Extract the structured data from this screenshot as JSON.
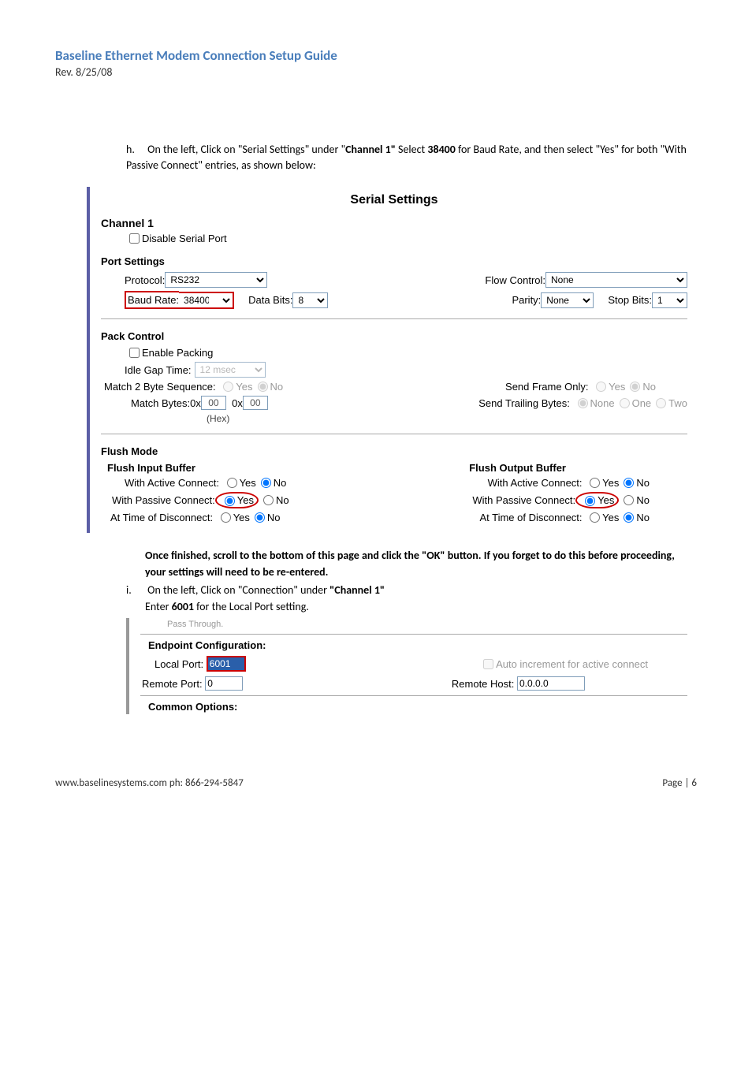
{
  "header": {
    "title": "Baseline Ethernet Modem Connection Setup Guide",
    "rev": "Rev. 8/25/08"
  },
  "instr_h": {
    "letter": "h.",
    "text1": "On the left, Click on \"Serial Settings\" under \"",
    "bold1": "Channel 1\"",
    "text2": "  Select ",
    "bold2": "38400",
    "text3": " for Baud Rate, and then select \"Yes\" for both \"With Passive Connect\" entries, as shown below:"
  },
  "serial": {
    "title": "Serial Settings",
    "channel": "Channel 1",
    "disable_label": "Disable Serial Port",
    "port_settings": "Port Settings",
    "protocol_label": "Protocol:",
    "protocol_value": "RS232",
    "flow_label": "Flow Control:",
    "flow_value": "None",
    "baud_label": "Baud Rate:",
    "baud_value": "38400",
    "databits_label": "Data Bits:",
    "databits_value": "8",
    "parity_label": "Parity:",
    "parity_value": "None",
    "stopbits_label": "Stop Bits:",
    "stopbits_value": "1",
    "pack_control": "Pack Control",
    "enable_packing": "Enable Packing",
    "idle_label": "Idle Gap Time:",
    "idle_value": "12 msec",
    "m2b_label": "Match 2 Byte Sequence:",
    "yes": "Yes",
    "no": "No",
    "sfo_label": "Send Frame Only:",
    "mbytes_label": "Match Bytes:",
    "hex_hint": "(Hex)",
    "mb1": "00",
    "mb2": "00",
    "0x": "0x",
    "stb_label": "Send Trailing Bytes:",
    "none": "None",
    "one": "One",
    "two": "Two",
    "flush_mode": "Flush Mode",
    "fib": "Flush Input Buffer",
    "fob": "Flush Output Buffer",
    "wac": "With Active Connect:",
    "wpc": "With Passive Connect:",
    "atd": "At Time of Disconnect:"
  },
  "after": {
    "line1a": "Once finished, scroll to the bottom of this page and click the \"OK\" button. If you forget to do this before proceeding, your settings will need to be re-entered.",
    "i_label": "i.",
    "i_text1": "On the left, Click on \"Connection\" under ",
    "i_bold": "\"Channel 1\"",
    "enter1": "Enter ",
    "enter_bold": "6001",
    "enter2": " for the Local Port setting.",
    "pass_fragment": "Pass Through."
  },
  "endpoint": {
    "title": "Endpoint Configuration:",
    "local_label": "Local Port:",
    "local_value": "6001",
    "auto_label": "Auto increment for active connect",
    "remote_port_label": "Remote Port:",
    "remote_port_value": "0",
    "remote_host_label": "Remote Host:",
    "remote_host_value": "0.0.0.0",
    "common": "Common Options:"
  },
  "footer": {
    "left": "www.baselinesystems.com    ph: 866-294-5847",
    "right": "Page | 6"
  }
}
